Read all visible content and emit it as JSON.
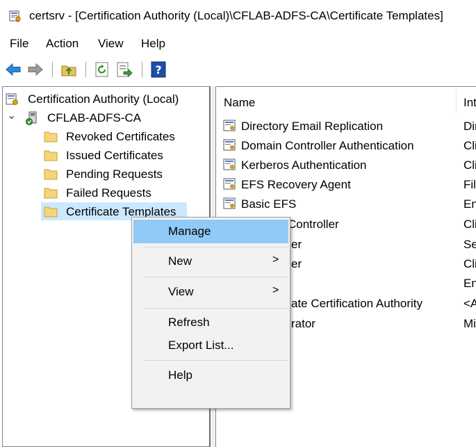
{
  "window": {
    "title": "certsrv - [Certification Authority (Local)\\CFLAB-ADFS-CA\\Certificate Templates]"
  },
  "menubar": [
    "File",
    "Action",
    "View",
    "Help"
  ],
  "toolbar": {
    "icons": [
      "back-icon",
      "forward-icon",
      "up-folder-icon",
      "refresh-icon",
      "export-list-icon",
      "help-icon"
    ]
  },
  "tree": {
    "root": "Certification Authority (Local)",
    "ca": "CFLAB-ADFS-CA",
    "expand_glyph": "⌄",
    "items": [
      "Revoked Certificates",
      "Issued Certificates",
      "Pending Requests",
      "Failed Requests",
      "Certificate Templates"
    ]
  },
  "list": {
    "columns": [
      "Name",
      "Int"
    ],
    "rows": [
      {
        "name": "Directory Email Replication",
        "intended": "Dir"
      },
      {
        "name": "Domain Controller Authentication",
        "intended": "Cli"
      },
      {
        "name": "Kerberos Authentication",
        "intended": "Cli"
      },
      {
        "name": "EFS Recovery Agent",
        "intended": "Fil"
      },
      {
        "name": "Basic EFS",
        "intended": "En"
      },
      {
        "name": "Controller",
        "intended": "Cli"
      },
      {
        "name": "er",
        "intended": "Se"
      },
      {
        "name": "er",
        "intended": "Cli"
      },
      {
        "name": "",
        "intended": "En"
      },
      {
        "name": "ate Certification Authority",
        "intended": "<A"
      },
      {
        "name": "rator",
        "intended": "Mi"
      }
    ]
  },
  "context_menu": {
    "manage": "Manage",
    "new": "New",
    "view": "View",
    "refresh": "Refresh",
    "export": "Export List...",
    "help": "Help",
    "submenu_arrow": ">"
  },
  "colors": {
    "selection": "#cce8ff",
    "menu_hover": "#91c9f7",
    "menu_bg": "#f2f2f2"
  }
}
